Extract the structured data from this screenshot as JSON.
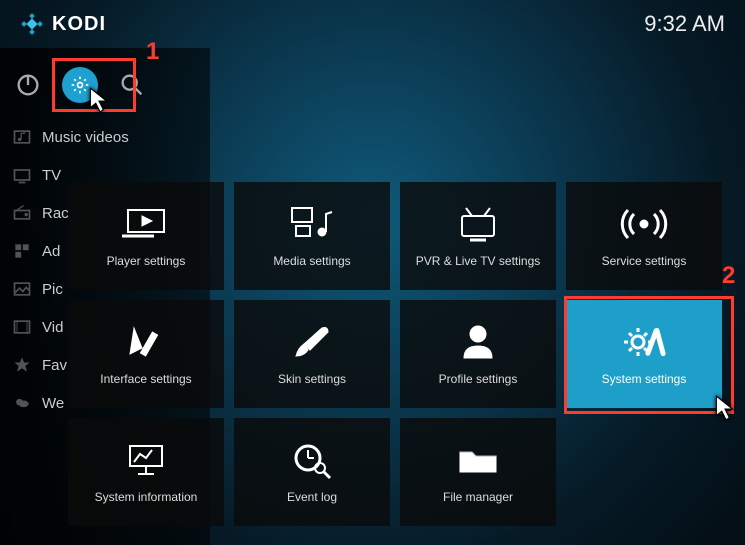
{
  "header": {
    "app_name": "KODI",
    "clock": "9:32 AM"
  },
  "rail": {
    "items": [
      {
        "label": "Music videos"
      },
      {
        "label": "TV"
      },
      {
        "label": "Rac"
      },
      {
        "label": "Ad"
      },
      {
        "label": "Pic"
      },
      {
        "label": "Vid"
      },
      {
        "label": "Fav"
      },
      {
        "label": "We"
      }
    ]
  },
  "tiles": [
    {
      "label": "Player settings"
    },
    {
      "label": "Media settings"
    },
    {
      "label": "PVR & Live TV settings"
    },
    {
      "label": "Service settings"
    },
    {
      "label": "Interface settings"
    },
    {
      "label": "Skin settings"
    },
    {
      "label": "Profile settings"
    },
    {
      "label": "System settings"
    },
    {
      "label": "System information"
    },
    {
      "label": "Event log"
    },
    {
      "label": "File manager"
    }
  ],
  "annotations": {
    "num1": "1",
    "num2": "2"
  }
}
